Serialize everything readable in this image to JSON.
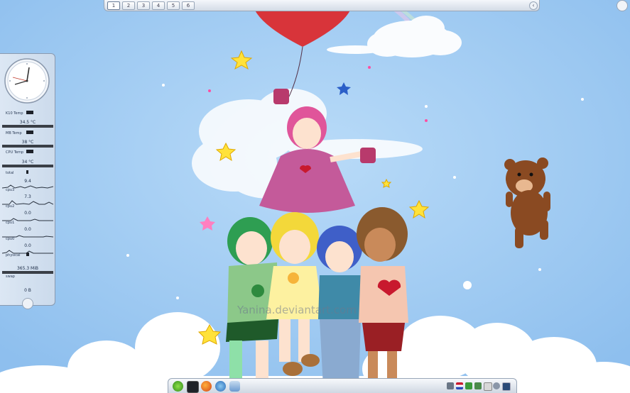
{
  "pager": {
    "desktops": [
      "1",
      "2",
      "3",
      "4",
      "5",
      "6"
    ],
    "active_index": 0
  },
  "sysmon": {
    "k10_temp": {
      "label": "K10 Temp",
      "value": "34.5 °C"
    },
    "mb_temp": {
      "label": "MB Temp",
      "value": "38 °C"
    },
    "cpu_temp": {
      "label": "CPU Temp",
      "value": "34 °C"
    },
    "total": {
      "label": "total",
      "value": "9.4"
    },
    "cpu3": {
      "label": "cpu3",
      "value": "7.3"
    },
    "cpu2": {
      "label": "cpu2",
      "value": "0.0"
    },
    "cpu1": {
      "label": "cpu1",
      "value": "0.0"
    },
    "cpu0": {
      "label": "cpu0",
      "value": "0.0"
    },
    "physical": {
      "label": "physical",
      "value": "365.3 MiB"
    },
    "swap": {
      "label": "swap",
      "value": "0 B"
    }
  },
  "wallpaper": {
    "watermark": "Yanina.deviantart.com"
  },
  "taskbar": {
    "launchers": [
      "kde-menu-icon",
      "terminal-icon",
      "firefox-icon",
      "network-icon",
      "database-icon"
    ],
    "tray": [
      "volume-icon",
      "flag-icon",
      "clipboard-icon",
      "network-tray-icon",
      "battery-icon",
      "info-icon",
      "display-icon"
    ]
  },
  "colors": {
    "sky": "#9cc8f0",
    "panel": "#dde5f0",
    "balloon": "#d8343a",
    "bear": "#8a4a22"
  }
}
